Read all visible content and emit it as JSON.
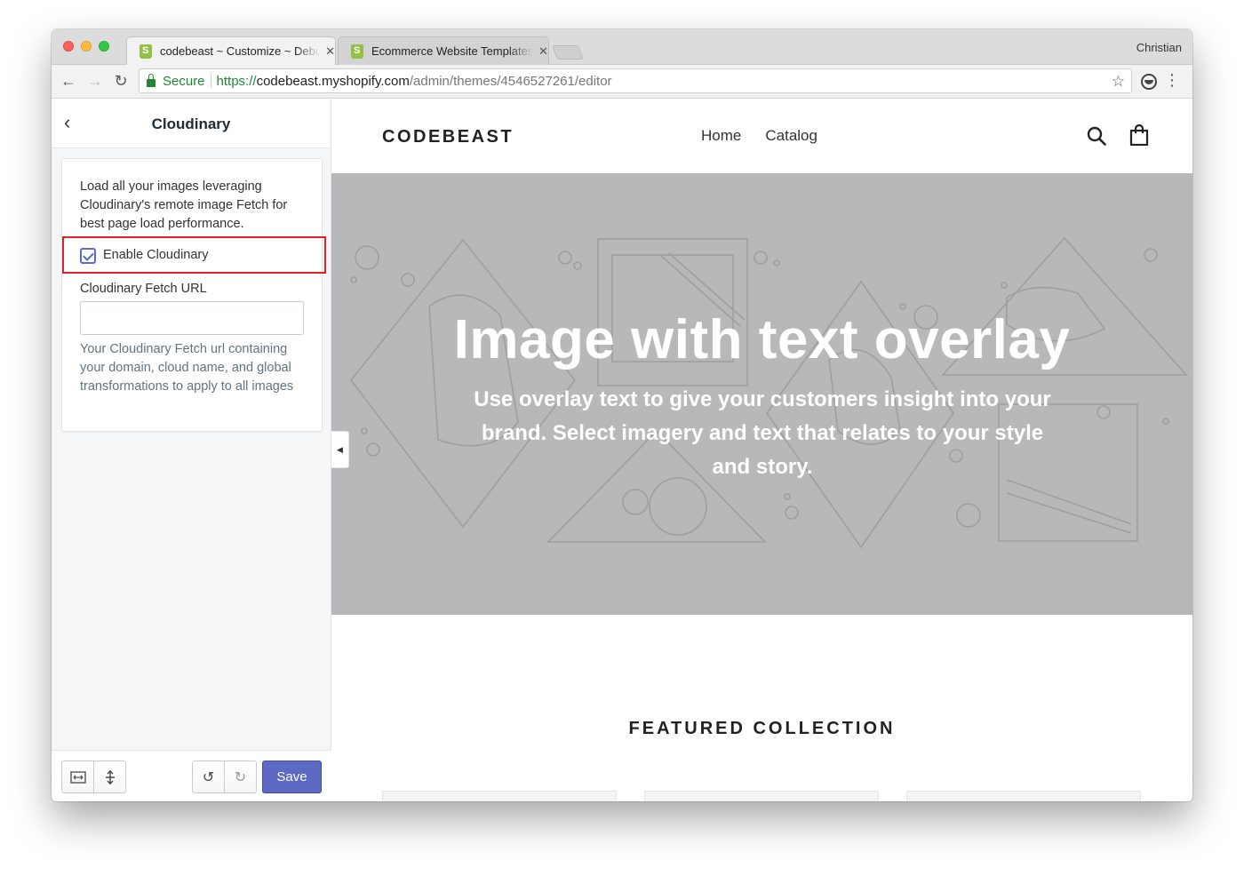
{
  "browser": {
    "profile_name": "Christian",
    "tabs": [
      {
        "title": "codebeast ~ Customize ~ Debut",
        "active": true
      },
      {
        "title": "Ecommerce Website Templates",
        "active": false
      }
    ],
    "address": {
      "secure_label": "Secure",
      "url_scheme": "https://",
      "url_host": "codebeast.myshopify.com",
      "url_path": "/admin/themes/4546527261/editor"
    }
  },
  "sidebar": {
    "title": "Cloudinary",
    "description": "Load all your images leveraging Cloudinary's remote image Fetch for best page load performance.",
    "enable_label": "Enable Cloudinary",
    "enable_checked": true,
    "fetch_url_label": "Cloudinary Fetch URL",
    "fetch_url_value": "",
    "fetch_url_help": "Your Cloudinary Fetch url containing your domain, cloud name, and global transformations to apply to all images",
    "save_label": "Save",
    "highlight_color": "#e3202a",
    "accent_color": "#5c6ac4"
  },
  "store": {
    "logo": "CODEBEAST",
    "nav": [
      {
        "label": "Home"
      },
      {
        "label": "Catalog"
      }
    ],
    "hero": {
      "title": "Image with text overlay",
      "subtitle": "Use overlay text to give your customers insight into your brand. Select imagery and text that relates to your style and story.",
      "background_color": "#b7b8ba"
    },
    "featured_heading": "FEATURED COLLECTION"
  }
}
